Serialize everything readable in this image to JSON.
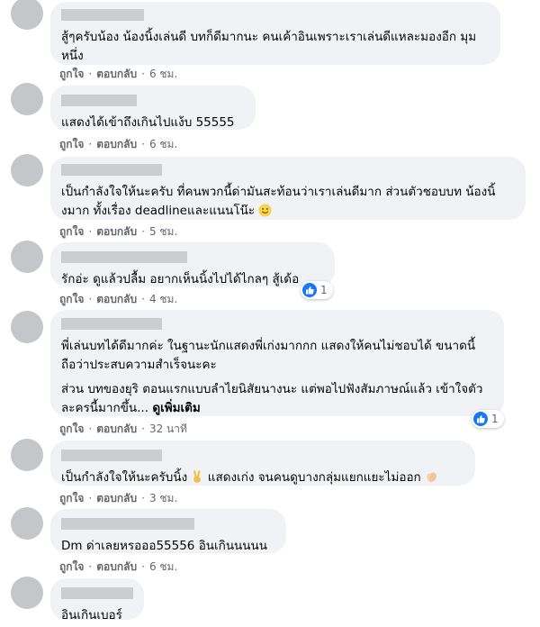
{
  "actions": {
    "like": "ถูกใจ",
    "reply": "ตอบกลับ"
  },
  "comments": [
    {
      "text": [
        "สู้ๆครับน้อง น้องนิ้งเล่นดี บทก็ดีมากนะ คนเค้าอินเพราะเราเล่นดีแหละมองอีก มุมหนึ่ง"
      ],
      "time": "6 ชม."
    },
    {
      "text": [
        "แสดงได้เข้าถึงเกินไปแง้บ 55555"
      ],
      "time": "6 ชม."
    },
    {
      "text": [
        "เป็นกำลังใจให้นะครับ ที่คนพวกนี้ด่ามันสะท้อนว่าเราเล่นดีมาก ส่วนตัวชอบบท น้องนิ้งมาก ทั้งเรื่อง deadlineและแนนโน๊ะ"
      ],
      "time": "5 ชม."
    },
    {
      "text": [
        "รักอ่ะ ดูแล้วปลื้ม อยากเห็นนิ้งไปได้ไกลๆ สู้เด้อ"
      ],
      "time": "4 ชม.",
      "reaction_count": "1"
    },
    {
      "text": [
        "พี่เล่นบทได้ดีมากค่ะ ในฐานะนักแสดงพี่เก่งมากกก แสดงให้คนไม่ชอบได้ ขนาดนี้ ถือว่าประสบความสำเร็จนะคะ",
        "ส่วน บทของยุริ ตอนแรกแบบลำไยนิสัยนางนะ แต่พอไปฟังสัมภาษณ์แล้ว เข้าใจตัวละครนี้มากขึ้น..."
      ],
      "see_more": "ดูเพิ่มเติม",
      "time": "32 นาที",
      "reaction_count": "1"
    },
    {
      "text": [
        "เป็นกำลังใจให้นะครับนิ้ง",
        "แสดงเก่ง จนคนดูบางกลุ่มแยกแยะไม่ออก"
      ],
      "time": "3 ชม."
    },
    {
      "text": [
        "Dm ด่าเลยหรอออ55556 อินเกินนนนน"
      ],
      "time": "6 ชม."
    },
    {
      "text": [
        "อินเกินเบอร์"
      ]
    }
  ]
}
